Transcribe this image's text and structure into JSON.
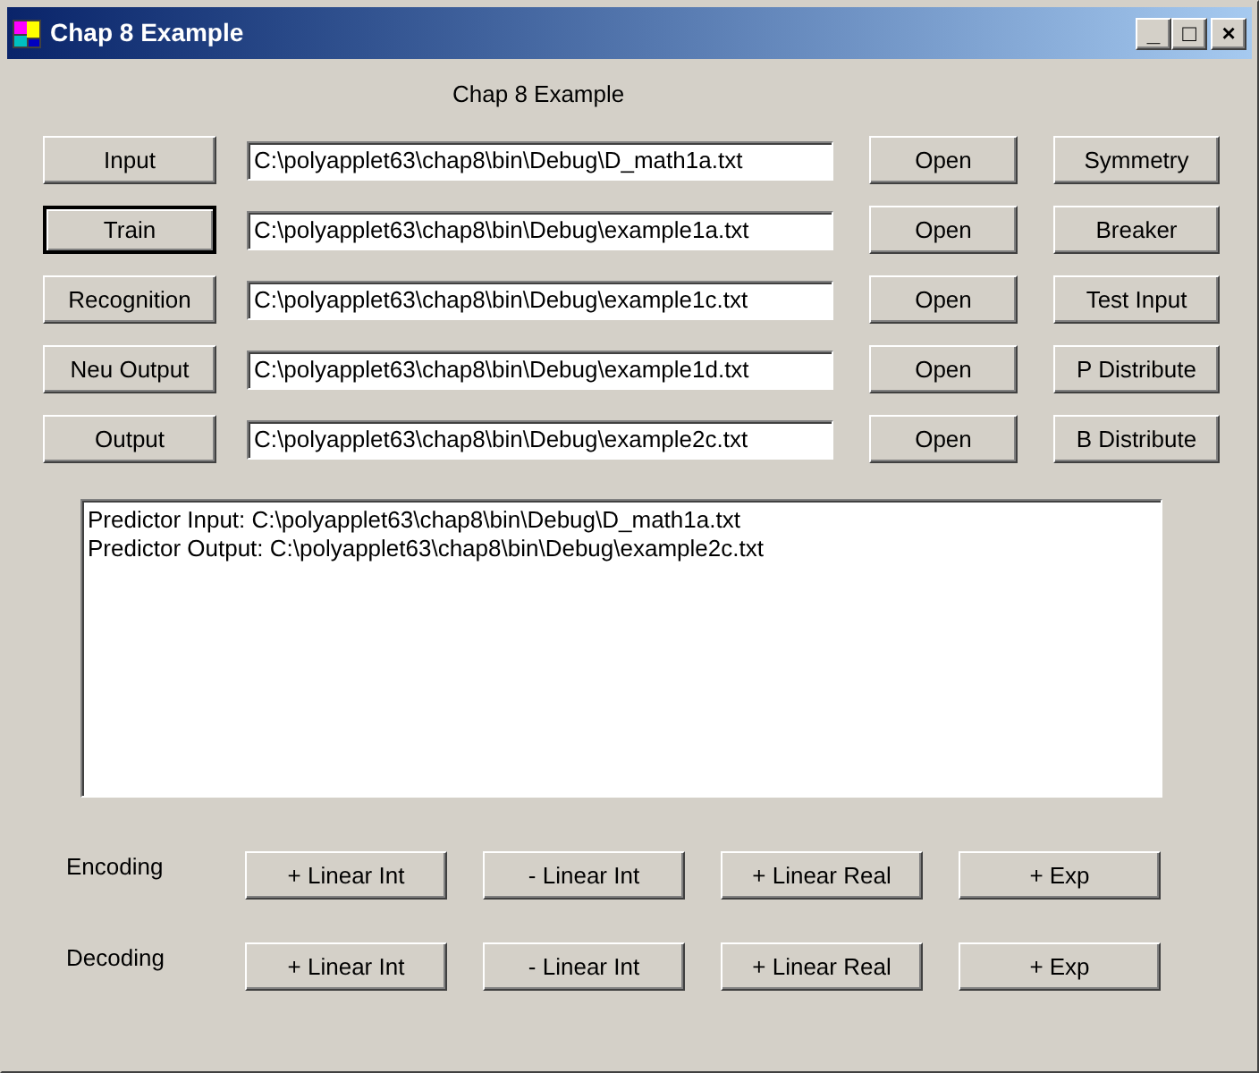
{
  "window": {
    "title": "Chap 8 Example",
    "controls": [
      "_",
      "□",
      "×"
    ]
  },
  "heading": "Chap 8 Example",
  "rows": [
    {
      "button": "Input",
      "focused": false,
      "path": "C:\\polyapplet63\\chap8\\bin\\Debug\\D_math1a.txt",
      "open": "Open",
      "action": "Symmetry"
    },
    {
      "button": "Train",
      "focused": true,
      "path": "C:\\polyapplet63\\chap8\\bin\\Debug\\example1a.txt",
      "open": "Open",
      "action": "Breaker"
    },
    {
      "button": "Recognition",
      "focused": false,
      "path": "C:\\polyapplet63\\chap8\\bin\\Debug\\example1c.txt",
      "open": "Open",
      "action": "Test Input"
    },
    {
      "button": "Neu Output",
      "focused": false,
      "path": "C:\\polyapplet63\\chap8\\bin\\Debug\\example1d.txt",
      "open": "Open",
      "action": "P Distribute"
    },
    {
      "button": "Output",
      "focused": false,
      "path": "C:\\polyapplet63\\chap8\\bin\\Debug\\example2c.txt",
      "open": "Open",
      "action": "B Distribute"
    }
  ],
  "log": [
    "Predictor Input: C:\\polyapplet63\\chap8\\bin\\Debug\\D_math1a.txt",
    "Predictor Output: C:\\polyapplet63\\chap8\\bin\\Debug\\example2c.txt"
  ],
  "coding": [
    {
      "label": "Encoding",
      "buttons": [
        "+ Linear Int",
        "- Linear Int",
        "+ Linear Real",
        "+ Exp"
      ]
    },
    {
      "label": "Decoding",
      "buttons": [
        "+ Linear Int",
        "- Linear Int",
        "+ Linear Real",
        "+ Exp"
      ]
    }
  ]
}
